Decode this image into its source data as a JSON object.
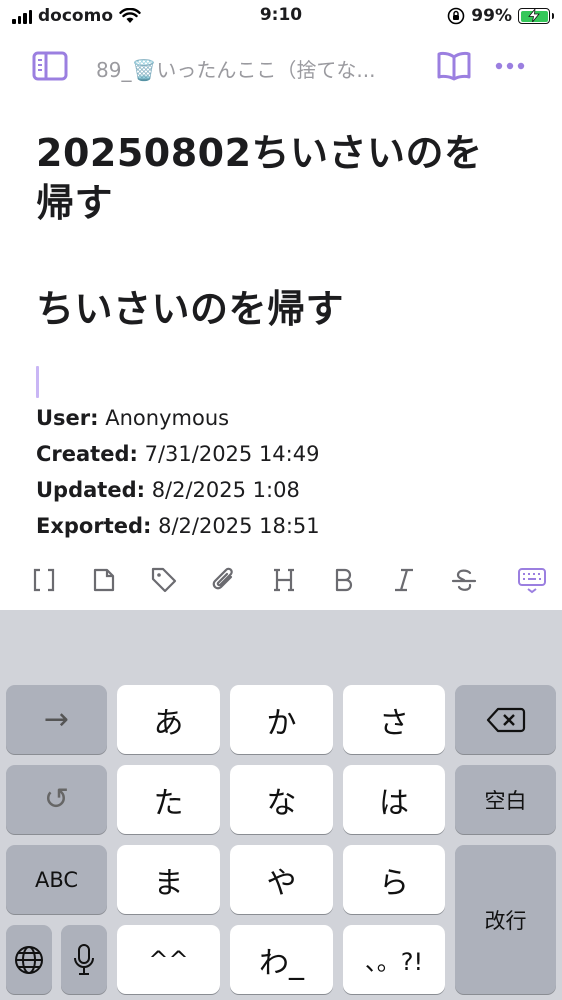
{
  "status_bar": {
    "carrier": "docomo",
    "time": "9:10",
    "battery": "99%"
  },
  "nav": {
    "title": "89_🗑️いったんここ（捨てな...",
    "sidebar_icon": "sidebar-icon",
    "reader_icon": "book-icon",
    "more_icon": "more-icon"
  },
  "note": {
    "title_line1": "20250802ちいさいのを",
    "title_line2": "帰す",
    "heading": "ちいさいのを帰す",
    "meta": [
      {
        "label": "User:",
        "value": "Anonymous"
      },
      {
        "label": "Created:",
        "value": "7/31/2025 14:49"
      },
      {
        "label": "Updated:",
        "value": "8/2/2025 1:08"
      },
      {
        "label": "Exported:",
        "value": "8/2/2025 18:51"
      }
    ]
  },
  "toolbar": {
    "items": [
      "wikilink-icon",
      "file-icon",
      "tag-icon",
      "attachment-icon",
      "heading-icon",
      "bold-icon",
      "italic-icon",
      "strikethrough-icon",
      "keyboard-dismiss-icon"
    ],
    "accent": "#9b7fe0"
  },
  "keyboard": {
    "row1": [
      "→",
      "あ",
      "か",
      "さ"
    ],
    "row2": [
      "↺",
      "た",
      "な",
      "は",
      "空白"
    ],
    "row3": [
      "ABC",
      "ま",
      "や",
      "ら",
      "改行"
    ],
    "row4": [
      "^^",
      "わ_",
      "、。?!"
    ]
  }
}
